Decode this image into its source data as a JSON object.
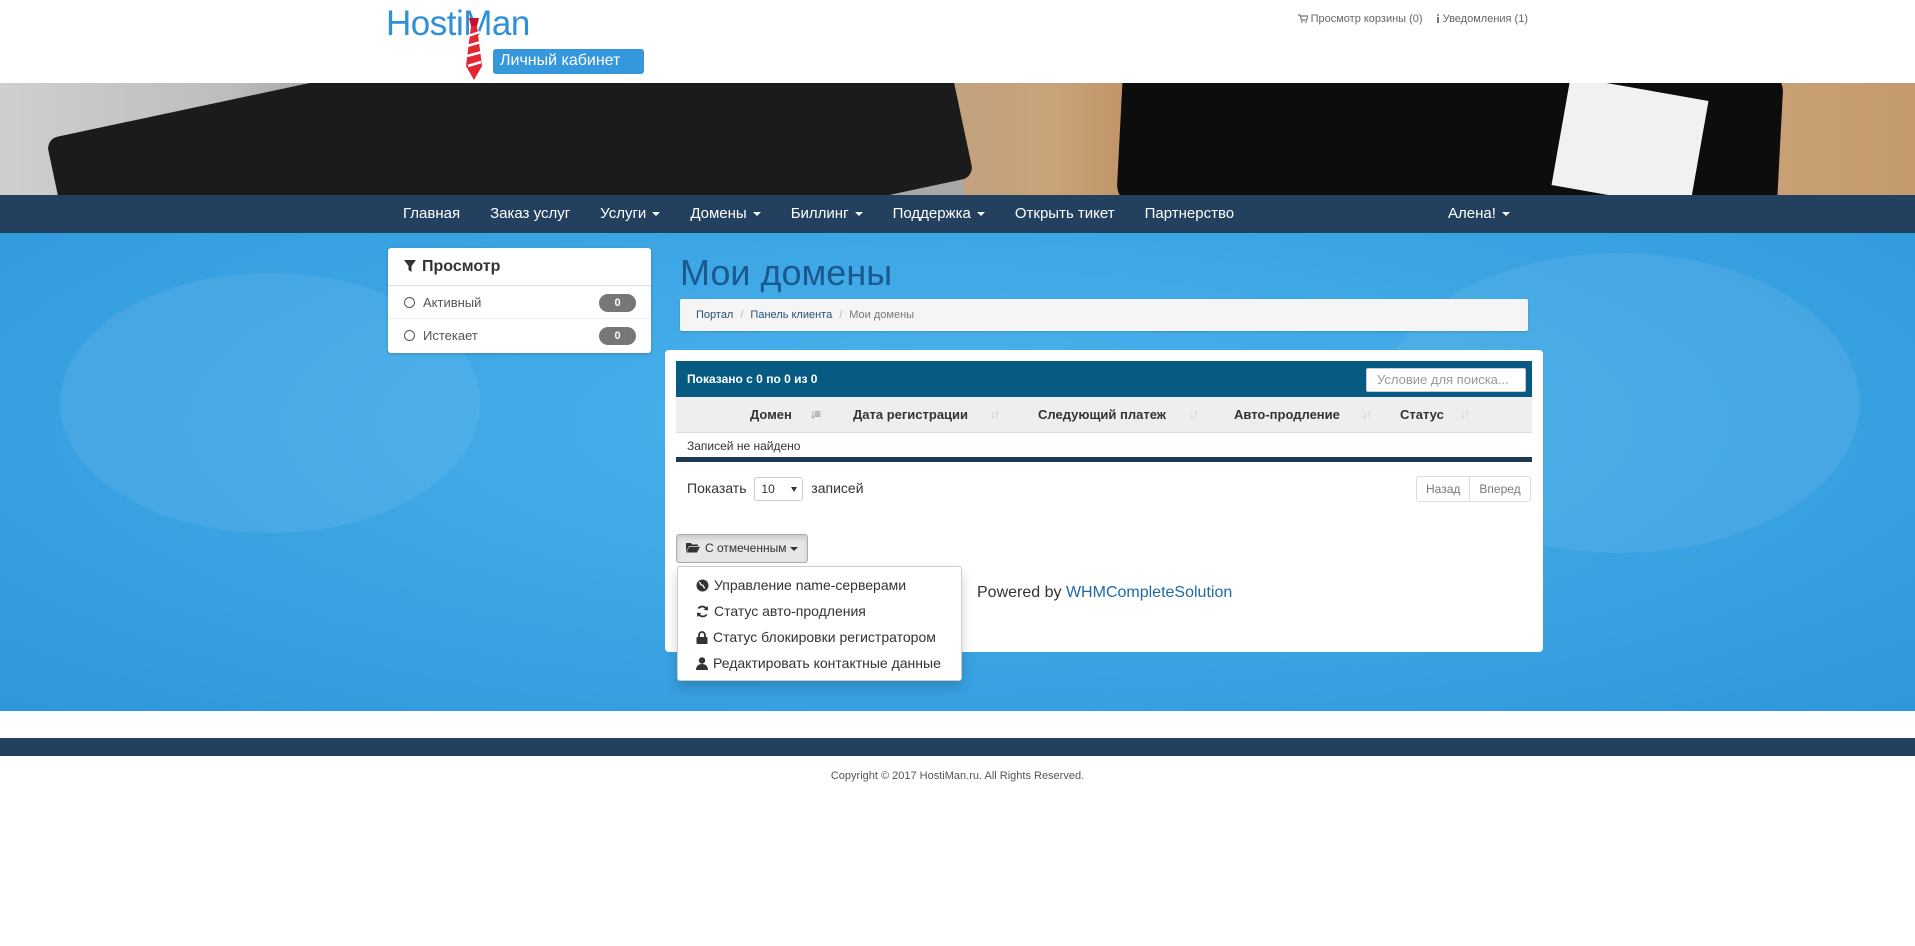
{
  "header": {
    "logo_text": "HostiMan",
    "logo_badge": "Личный кабинет",
    "cart_link": "Просмотр корзины (0)",
    "notifications_link": "Уведомления (1)"
  },
  "nav": {
    "items": [
      {
        "label": "Главная",
        "dropdown": false
      },
      {
        "label": "Заказ услуг",
        "dropdown": false
      },
      {
        "label": "Услуги",
        "dropdown": true
      },
      {
        "label": "Домены",
        "dropdown": true
      },
      {
        "label": "Биллинг",
        "dropdown": true
      },
      {
        "label": "Поддержка",
        "dropdown": true
      },
      {
        "label": "Открыть тикет",
        "dropdown": false
      },
      {
        "label": "Партнерство",
        "dropdown": false
      }
    ],
    "user": "Алена!"
  },
  "sidebar": {
    "title": "Просмотр",
    "filters": [
      {
        "label": "Активный",
        "count": "0"
      },
      {
        "label": "Истекает",
        "count": "0"
      }
    ]
  },
  "page": {
    "title": "Мои домены",
    "breadcrumb": [
      "Портал",
      "Панель клиента",
      "Мои домены"
    ]
  },
  "table": {
    "info": "Показано с 0 по 0 из 0",
    "search_placeholder": "Условие для поиска...",
    "columns": [
      "Домен",
      "Дата регистрации",
      "Следующий платеж",
      "Авто-продление",
      "Статус"
    ],
    "empty_text": "Записей не найдено",
    "length_prefix": "Показать",
    "length_value": "10",
    "length_suffix": "записей",
    "prev": "Назад",
    "next": "Вперед"
  },
  "bulk": {
    "button_label": "С отмеченным",
    "menu": [
      {
        "label": "Управление name-серверами",
        "icon": "globe-icon"
      },
      {
        "label": "Статус авто-продления",
        "icon": "refresh-icon"
      },
      {
        "label": "Статус блокировки регистратором",
        "icon": "lock-icon"
      },
      {
        "label": "Редактировать контактные данные",
        "icon": "user-icon"
      }
    ]
  },
  "footer": {
    "powered_prefix": "Powered by",
    "powered_link": "WHMCompleteSolution",
    "copyright": "Copyright © 2017 HostiMan.ru. All Rights Reserved."
  },
  "colors": {
    "nav_bg": "#23405f",
    "main_bg": "#3aa4e3",
    "table_header": "#075b82",
    "brand_blue": "#2f8fd8"
  }
}
